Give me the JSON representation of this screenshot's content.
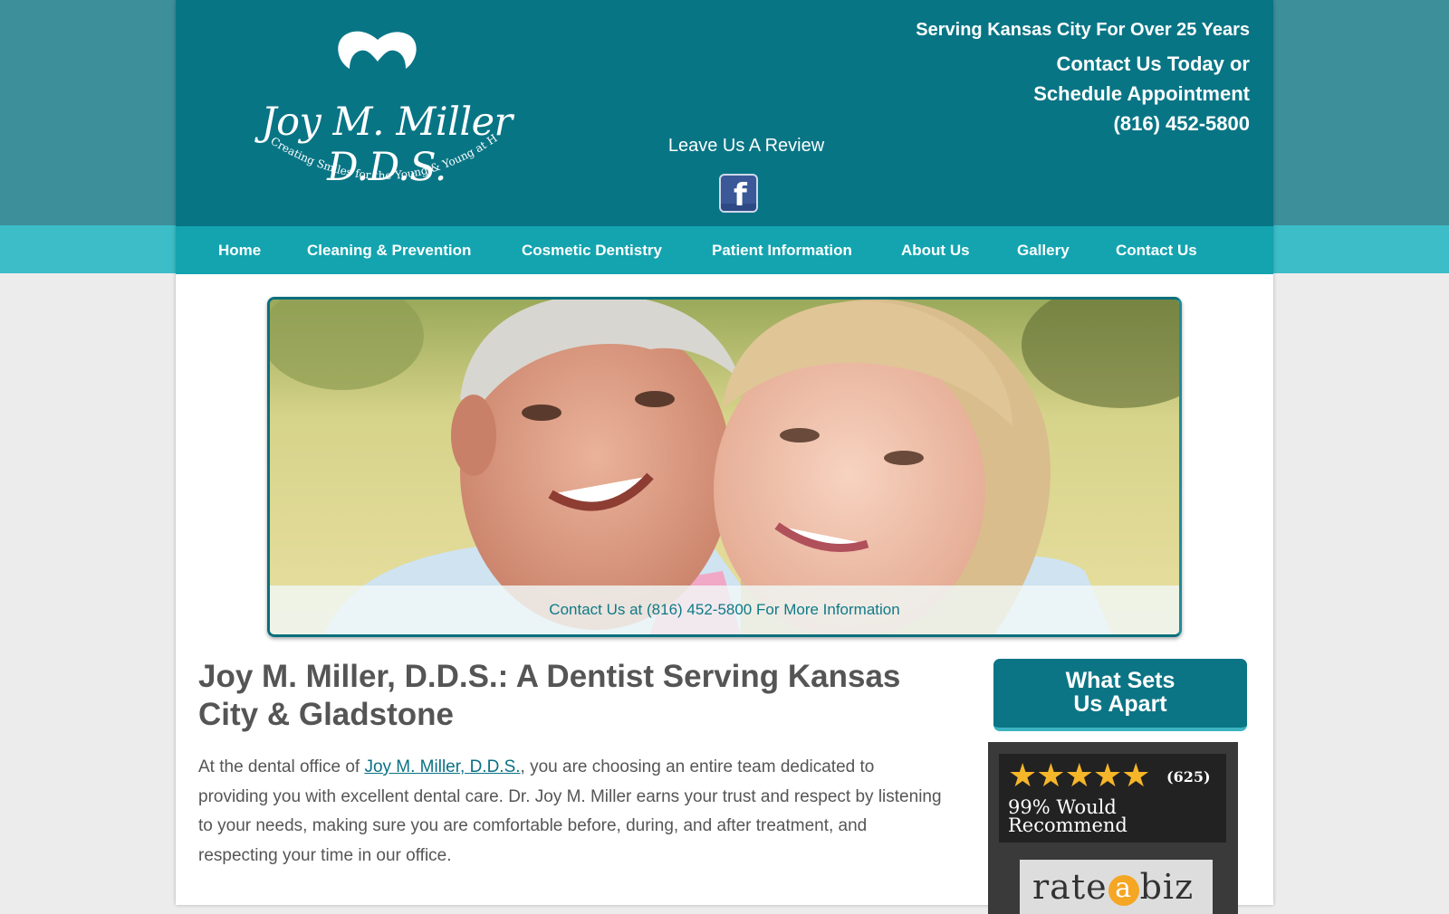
{
  "header": {
    "logo_name": "Joy M. Miller D.D.S.",
    "logo_tagline": "Creating Smiles for the Young & Young at Heart",
    "review_label": "Leave Us A Review",
    "facebook_icon": "facebook-icon",
    "serving": "Serving Kansas City For Over 25 Years",
    "contact_line1": "Contact Us Today or",
    "contact_line2": "Schedule Appointment",
    "phone": "(816) 452-5800"
  },
  "nav": {
    "items": [
      {
        "label": "Home"
      },
      {
        "label": "Cleaning & Prevention"
      },
      {
        "label": "Cosmetic Dentistry"
      },
      {
        "label": "Patient Information"
      },
      {
        "label": "About Us"
      },
      {
        "label": "Gallery"
      },
      {
        "label": "Contact Us"
      }
    ]
  },
  "hero": {
    "caption": "Contact Us at (816) 452-5800 For More Information"
  },
  "main": {
    "title": "Joy M. Miller, D.D.S.: A Dentist Serving Kansas City & Gladstone",
    "body_prefix": "At the dental office of ",
    "body_link": "Joy M. Miller, D.D.S.",
    "body_rest": ", you are choosing an entire team dedicated to providing you with excellent dental care. Dr. Joy M. Miller earns your trust and respect by listening to your needs, making sure you are comfortable before, during, and after treatment, and respecting your time in our office."
  },
  "sidebar": {
    "sets_line1": "What Sets",
    "sets_line2": "Us Apart",
    "rating_stars": 5,
    "rating_count": "(625)",
    "recommend_line1": "99% Would",
    "recommend_line2": "Recommend",
    "rateabiz_before": "rate",
    "rateabiz_a": "a",
    "rateabiz_after": "biz"
  },
  "colors": {
    "header_teal": "#087585",
    "nav_teal": "#13a4b0",
    "text_gray": "#555555",
    "link": "#0a7184",
    "star": "#f6b629"
  }
}
